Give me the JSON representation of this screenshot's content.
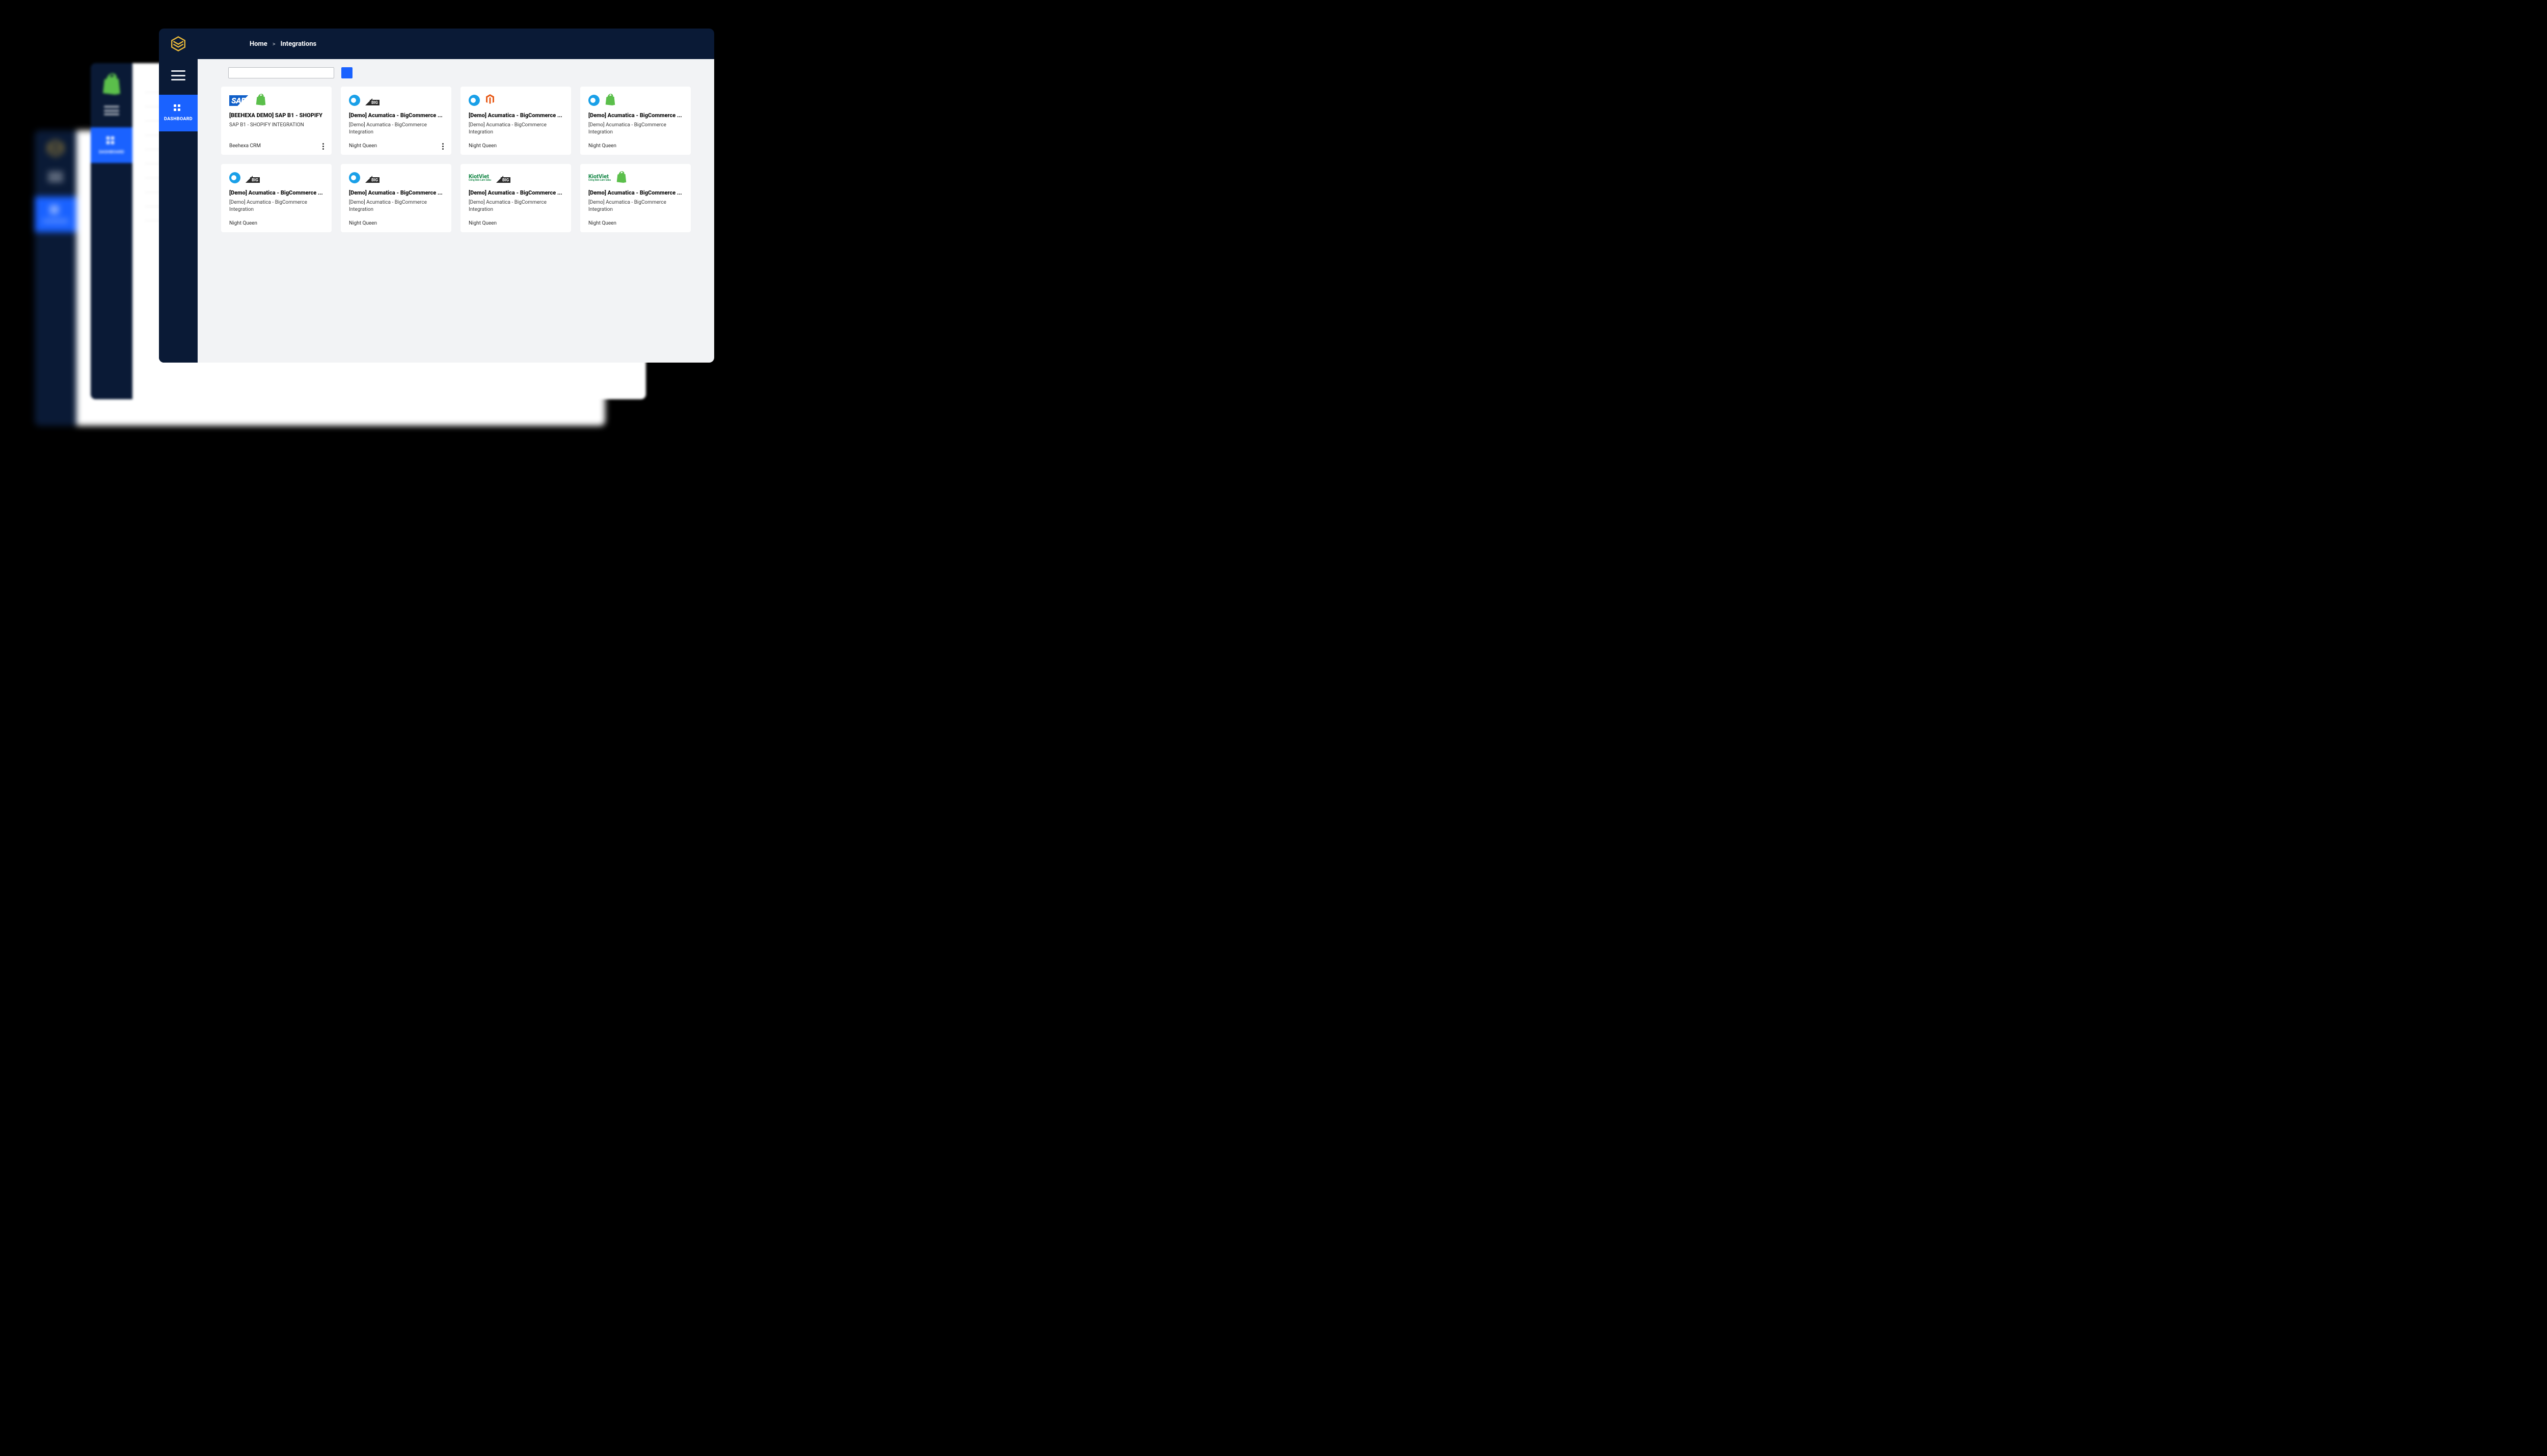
{
  "breadcrumbs": {
    "home": "Home",
    "sep": ">",
    "page": "Integrations"
  },
  "sidebar": {
    "dashboard_label": "DASHBOARD"
  },
  "bg2": {
    "dashboard_label": "DASHBOARD"
  },
  "bg3": {
    "dashboard_label": "DASHBOARD"
  },
  "search": {
    "placeholder": ""
  },
  "cards": [
    {
      "logos": [
        "sap",
        "shopify"
      ],
      "title": "[BEEHEXA DEMO] SAP B1 - SHOPIFY",
      "subtitle": "SAP B1 - SHOPIFY INTEGRATION",
      "subtitle_single": true,
      "owner": "Beehexa CRM",
      "has_menu": true
    },
    {
      "logos": [
        "acumatica",
        "big"
      ],
      "title": "[Demo] Acumatica - BigCommerce ...",
      "subtitle": "[Demo] Acumatica - BigCommerce Integration",
      "owner": "Night Queen",
      "has_menu": true
    },
    {
      "logos": [
        "acumatica",
        "magento"
      ],
      "title": "[Demo] Acumatica - BigCommerce ...",
      "subtitle": "[Demo] Acumatica - BigCommerce Integration",
      "owner": "Night Queen",
      "has_menu": false
    },
    {
      "logos": [
        "acumatica",
        "shopify"
      ],
      "title": "[Demo] Acumatica - BigCommerce ...",
      "subtitle": "[Demo] Acumatica - BigCommerce Integration",
      "owner": "Night Queen",
      "has_menu": false
    },
    {
      "logos": [
        "acumatica",
        "big"
      ],
      "title": "[Demo] Acumatica - BigCommerce ...",
      "subtitle": "[Demo] Acumatica - BigCommerce Integration",
      "owner": "Night Queen",
      "has_menu": false
    },
    {
      "logos": [
        "acumatica",
        "big"
      ],
      "title": "[Demo] Acumatica - BigCommerce ...",
      "subtitle": "[Demo] Acumatica - BigCommerce Integration",
      "owner": "Night Queen",
      "has_menu": false
    },
    {
      "logos": [
        "kiotviet",
        "big"
      ],
      "title": "[Demo] Acumatica - BigCommerce ...",
      "subtitle": "[Demo] Acumatica - BigCommerce Integration",
      "owner": "Night Queen",
      "has_menu": false
    },
    {
      "logos": [
        "kiotviet",
        "shopify"
      ],
      "title": "[Demo] Acumatica - BigCommerce ...",
      "subtitle": "[Demo] Acumatica - BigCommerce Integration",
      "owner": "Night Queen",
      "has_menu": false
    }
  ]
}
